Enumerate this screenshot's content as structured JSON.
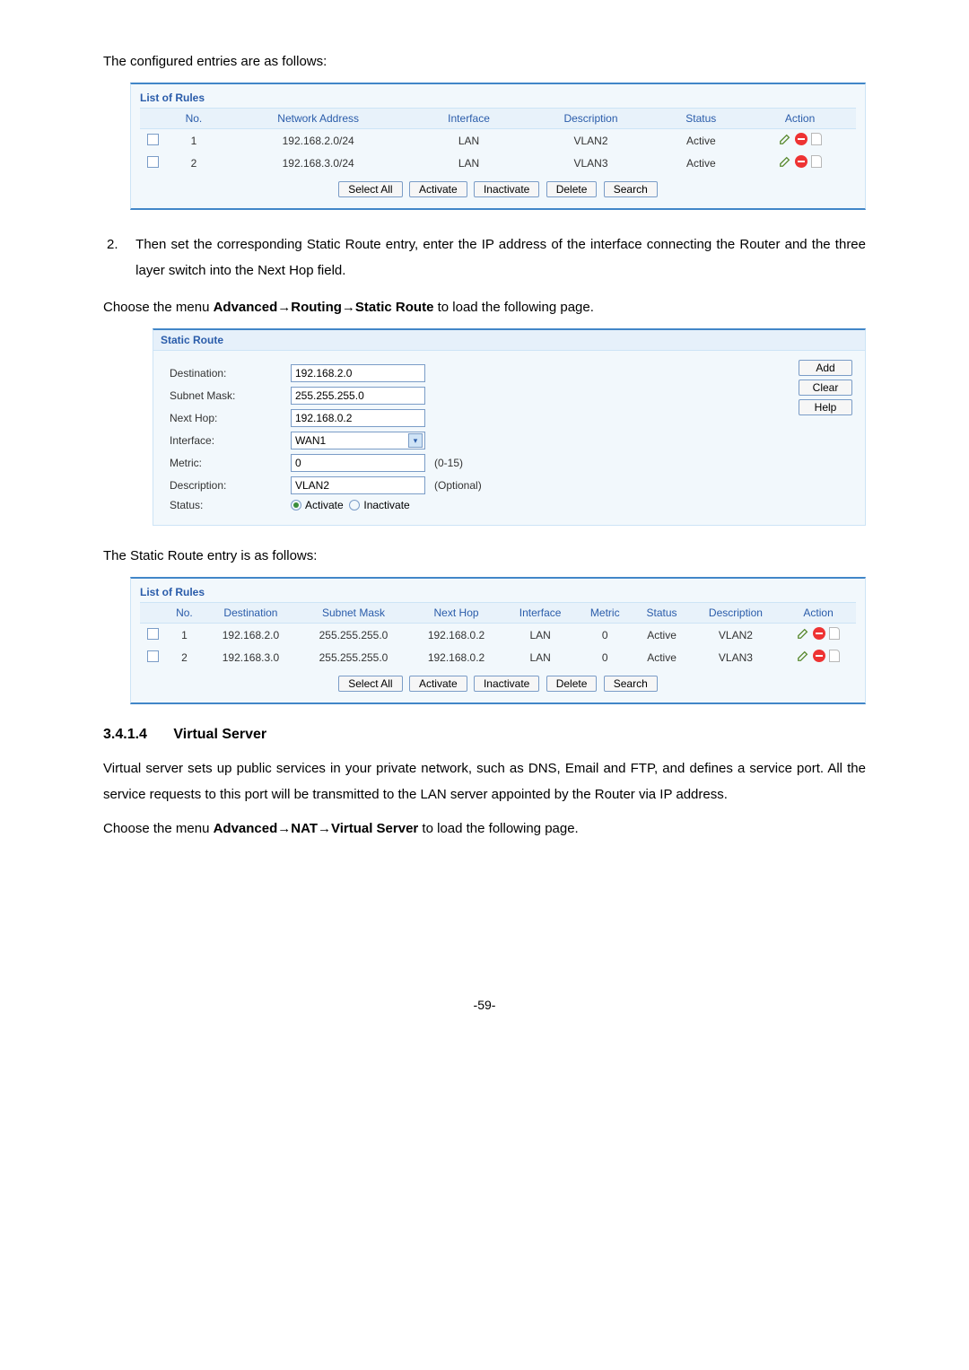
{
  "intro1": "The configured entries are as follows:",
  "rules1": {
    "title": "List of Rules",
    "headers": [
      "",
      "No.",
      "Network Address",
      "Interface",
      "Description",
      "Status",
      "Action"
    ],
    "rows": [
      {
        "no": "1",
        "addr": "192.168.2.0/24",
        "iface": "LAN",
        "desc": "VLAN2",
        "status": "Active"
      },
      {
        "no": "2",
        "addr": "192.168.3.0/24",
        "iface": "LAN",
        "desc": "VLAN3",
        "status": "Active"
      }
    ],
    "buttons": [
      "Select All",
      "Activate",
      "Inactivate",
      "Delete",
      "Search"
    ]
  },
  "step2_num": "2.",
  "step2_text": "Then set the corresponding Static Route entry, enter the IP address of the interface connecting the Router and the three layer switch into the Next Hop field.",
  "menu1_prefix": "Choose the menu ",
  "menu1_bold": "Advanced→Routing→Static Route",
  "menu1_suffix": " to load the following page.",
  "form": {
    "title": "Static Route",
    "fields": {
      "dest_label": "Destination:",
      "dest_val": "192.168.2.0",
      "mask_label": "Subnet Mask:",
      "mask_val": "255.255.255.0",
      "hop_label": "Next Hop:",
      "hop_val": "192.168.0.2",
      "iface_label": "Interface:",
      "iface_val": "WAN1",
      "metric_label": "Metric:",
      "metric_val": "0",
      "metric_hint": "(0-15)",
      "desc_label": "Description:",
      "desc_val": "VLAN2",
      "desc_hint": "(Optional)",
      "status_label": "Status:",
      "status_on": "Activate",
      "status_off": "Inactivate"
    },
    "side": [
      "Add",
      "Clear",
      "Help"
    ]
  },
  "intro2": "The Static Route entry is as follows:",
  "rules2": {
    "title": "List of Rules",
    "headers": [
      "",
      "No.",
      "Destination",
      "Subnet Mask",
      "Next Hop",
      "Interface",
      "Metric",
      "Status",
      "Description",
      "Action"
    ],
    "rows": [
      {
        "no": "1",
        "dest": "192.168.2.0",
        "mask": "255.255.255.0",
        "hop": "192.168.0.2",
        "iface": "LAN",
        "met": "0",
        "stat": "Active",
        "desc": "VLAN2"
      },
      {
        "no": "2",
        "dest": "192.168.3.0",
        "mask": "255.255.255.0",
        "hop": "192.168.0.2",
        "iface": "LAN",
        "met": "0",
        "stat": "Active",
        "desc": "VLAN3"
      }
    ],
    "buttons": [
      "Select All",
      "Activate",
      "Inactivate",
      "Delete",
      "Search"
    ]
  },
  "section_num": "3.4.1.4",
  "section_title": "Virtual Server",
  "para1": "Virtual server sets up public services in your private network, such as DNS, Email and FTP, and defines a service port. All the service requests to this port will be transmitted to the LAN server appointed by the Router via IP address.",
  "menu2_prefix": "Choose the menu ",
  "menu2_bold": "Advanced→NAT→Virtual Server",
  "menu2_suffix": " to load the following page.",
  "page_num": "-59-"
}
